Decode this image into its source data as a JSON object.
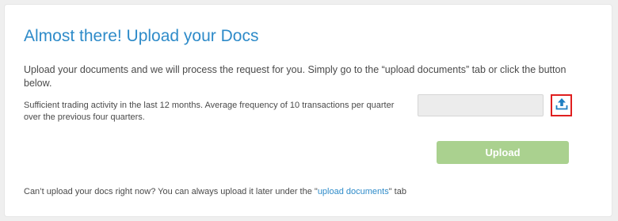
{
  "card": {
    "title": "Almost there! Upload your Docs",
    "intro": "Upload your documents and we will process the request for you. Simply go to the “upload documents” tab or click the button below.",
    "requirement": "Sufficient trading activity in the last 12 months. Average frequency of 10 transactions per quarter over the previous four quarters.",
    "file_input_value": "",
    "upload_icon": "upload-icon",
    "upload_button_label": "Upload",
    "footer_prefix": "Can’t upload your docs right now? You can always upload it later under the \"",
    "footer_link": "upload documents",
    "footer_suffix": "\" tab"
  },
  "colors": {
    "title": "#2e8bc9",
    "link": "#2e8bc9",
    "upload_button": "#aad18f",
    "icon_highlight": "#e01f1f"
  }
}
